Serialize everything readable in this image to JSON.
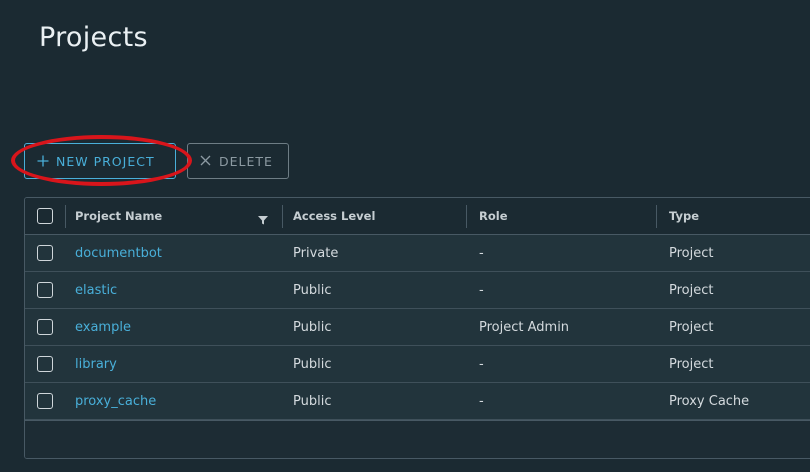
{
  "page": {
    "title": "Projects"
  },
  "toolbar": {
    "new_project_label": "NEW PROJECT",
    "delete_label": "DELETE"
  },
  "table": {
    "columns": [
      "Project Name",
      "Access Level",
      "Role",
      "Type"
    ],
    "rows": [
      {
        "name": "documentbot",
        "access": "Private",
        "role": "-",
        "type": "Project"
      },
      {
        "name": "elastic",
        "access": "Public",
        "role": "-",
        "type": "Project"
      },
      {
        "name": "example",
        "access": "Public",
        "role": "Project Admin",
        "type": "Project"
      },
      {
        "name": "library",
        "access": "Public",
        "role": "-",
        "type": "Project"
      },
      {
        "name": "proxy_cache",
        "access": "Public",
        "role": "-",
        "type": "Proxy Cache"
      }
    ]
  },
  "colors": {
    "background": "#1b2a32",
    "accent": "#49afd9",
    "highlight_annotation": "#d9151b"
  },
  "icons": {
    "new_project": "plus-icon",
    "delete": "close-icon",
    "filter": "filter-icon"
  }
}
